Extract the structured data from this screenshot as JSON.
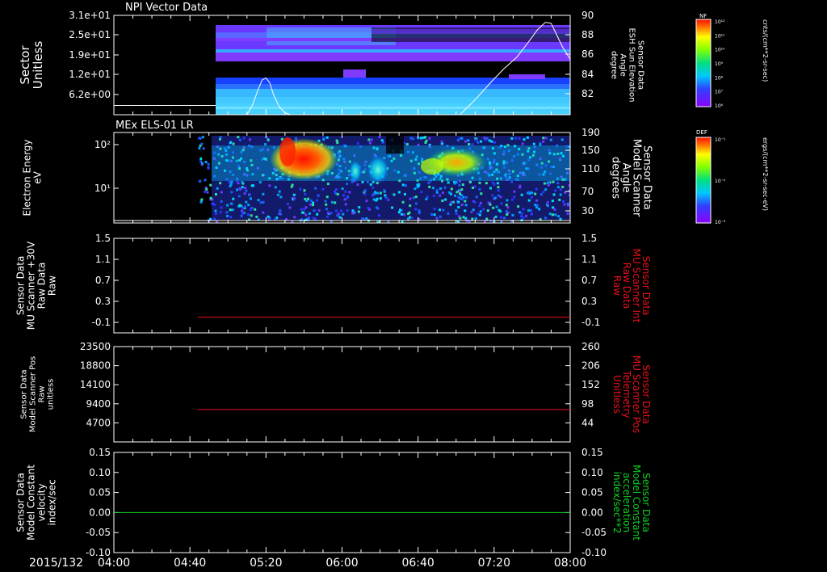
{
  "colors": {
    "axis": "#ffffff",
    "red": "#e8101a",
    "green": "#10d020",
    "bg": "#000000"
  },
  "time_axis": {
    "date_label": "2015/132",
    "ticks": [
      "04:00",
      "04:40",
      "05:20",
      "06:00",
      "06:40",
      "07:20",
      "08:00"
    ]
  },
  "chart_data": [
    {
      "type": "heatmap",
      "title": "NPI Vector Data",
      "ylabel": "Sector\nUnitless",
      "yticks": [
        "3.1e+01",
        "2.5e+01",
        "1.9e+01",
        "1.2e+01",
        "6.2e+00"
      ],
      "right_label": "Sensor Data\nESH Sun Elevation\nAngle\ndegree",
      "right_ticks": [
        "90",
        "88",
        "86",
        "84",
        "82"
      ],
      "right_range": [
        80,
        90
      ],
      "data_start_time": "04:46",
      "overlay_line": {
        "color": "#ffffff",
        "x": [
          "05:10",
          "05:13",
          "05:16",
          "05:18",
          "05:20",
          "05:22",
          "05:24",
          "05:27",
          "05:30",
          "05:33",
          "07:02",
          "07:10",
          "07:18",
          "07:25",
          "07:32",
          "07:38",
          "07:43",
          "07:47",
          "07:50",
          "07:53",
          "07:56",
          "08:00"
        ],
        "y": [
          80,
          81,
          82.6,
          83.5,
          83.7,
          83.2,
          82,
          80.8,
          80.2,
          80,
          80,
          81.5,
          83.2,
          84.6,
          85.8,
          87.3,
          88.6,
          89.3,
          89.2,
          88,
          86.8,
          85.6
        ]
      },
      "colorbar": {
        "label": "NF",
        "units": "cnts/(cm**2-sr-sec)",
        "ticks": [
          "10¹²",
          "10¹¹",
          "10¹⁰",
          "10⁹",
          "10⁸",
          "10⁷",
          "10⁶"
        ]
      }
    },
    {
      "type": "heatmap",
      "title": "MEx ELS-01 LR",
      "ylabel": "Electron Energy\neV",
      "yticks": [
        "10²",
        "10¹"
      ],
      "right_label": "Sensor Data\nModel Scanner\nAngle\ndegrees",
      "right_ticks": [
        "190",
        "150",
        "110",
        "70",
        "30"
      ],
      "right_range": [
        0,
        190
      ],
      "data_start_time": "04:44",
      "overlay_line": {
        "color": "#ffffff",
        "x": [
          "04:00",
          "08:00"
        ],
        "y": [
          5,
          5
        ]
      },
      "colorbar": {
        "label": "DEF",
        "units": "ergs/(cm**2-sr-sec-eV)",
        "ticks": [
          "10⁻¹",
          "10⁻²",
          "10⁻³"
        ]
      }
    },
    {
      "type": "line",
      "ylabel": "Sensor Data\nMU Scanner +30V\nRaw Data\nRaw",
      "left_ticks": [
        "1.5",
        "1.1",
        "0.7",
        "0.3",
        "-0.1"
      ],
      "left_range": [
        -0.3,
        1.5
      ],
      "right_label": "Sensor Data\nMU Scanner Int\nRaw Data\nRaw",
      "right_ticks": [
        "1.5",
        "1.1",
        "0.7",
        "0.3",
        "-0.1"
      ],
      "right_range": [
        -0.3,
        1.5
      ],
      "series": [
        {
          "x": [
            "04:44",
            "08:00"
          ],
          "y": [
            0.0,
            0.0
          ],
          "color": "#e8101a"
        }
      ]
    },
    {
      "type": "line",
      "ylabel": "Sensor Data\nModel Scanner Pos\nRaw\nunitless",
      "left_ticks": [
        "23500",
        "18800",
        "14100",
        "9400",
        "4700"
      ],
      "left_range": [
        0,
        23500
      ],
      "right_label": "Sensor Data\nMU Scanner Pos\nTelemetry\nUnitless",
      "right_ticks": [
        "260",
        "206",
        "152",
        "98",
        "44"
      ],
      "right_range": [
        -10,
        260
      ],
      "series": [
        {
          "x": [
            "04:44",
            "08:00"
          ],
          "y": [
            8000,
            8000
          ],
          "color": "#e8101a"
        }
      ]
    },
    {
      "type": "line",
      "ylabel": "Sensor Data\nModel Constant\nvelocity\nindex/sec",
      "left_ticks": [
        "0.15",
        "0.10",
        "0.05",
        "0.00",
        "-0.05",
        "-0.10"
      ],
      "left_range": [
        -0.1,
        0.15
      ],
      "right_label": "Sensor Data\nModel Constant\nacceleration\nindex/sec**2",
      "right_ticks": [
        "0.15",
        "0.10",
        "0.05",
        "0.00",
        "-0.05",
        "-0.10"
      ],
      "right_range": [
        -0.1,
        0.15
      ],
      "series": [
        {
          "x": [
            "04:00",
            "08:00"
          ],
          "y": [
            0.0,
            0.0
          ],
          "color": "#10d020"
        }
      ]
    }
  ]
}
